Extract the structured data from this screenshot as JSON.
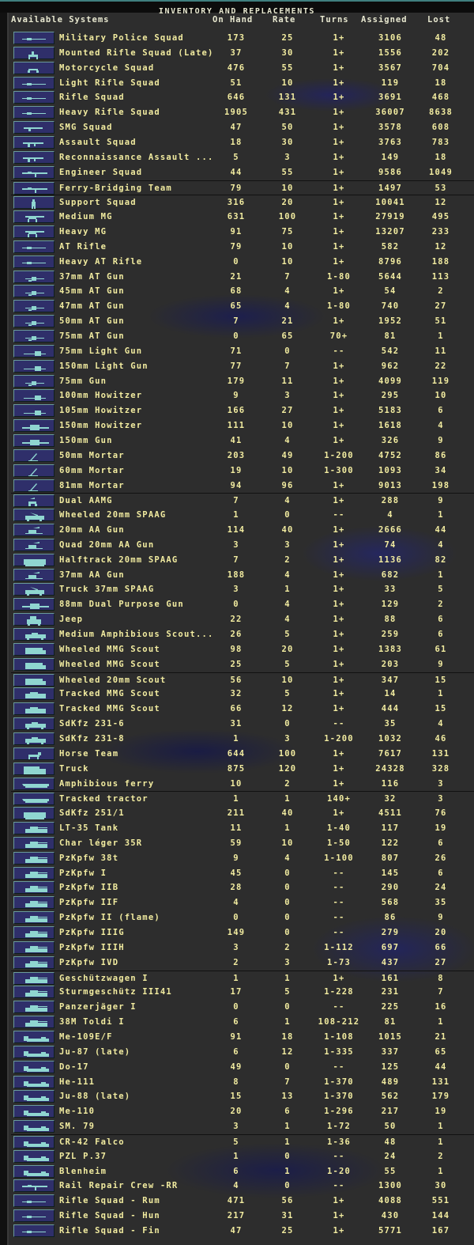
{
  "window_title": "INVENTORY AND REPLACEMENTS",
  "columns": [
    "Available Systems",
    "On Hand",
    "Rate",
    "Turns",
    "Assigned",
    "Lost"
  ],
  "rows": [
    [
      "Military Police Squad",
      "173",
      "25",
      "1+",
      "3106",
      "48",
      "rifle"
    ],
    [
      "Mounted Rifle Squad (Late)",
      "37",
      "30",
      "1+",
      "1556",
      "202",
      "horse-rider"
    ],
    [
      "Motorcycle Squad",
      "476",
      "55",
      "1+",
      "3567",
      "704",
      "motorcycle"
    ],
    [
      "Light Rifle Squad",
      "51",
      "10",
      "1+",
      "119",
      "18",
      "rifle"
    ],
    [
      "Rifle Squad",
      "646",
      "131",
      "1+",
      "3691",
      "468",
      "rifle"
    ],
    [
      "Heavy Rifle Squad",
      "1905",
      "431",
      "1+",
      "36007",
      "8638",
      "rifle"
    ],
    [
      "SMG Squad",
      "47",
      "50",
      "1+",
      "3578",
      "608",
      "smg"
    ],
    [
      "Assault Squad",
      "18",
      "30",
      "1+",
      "3763",
      "783",
      "assault-rifle"
    ],
    [
      "Reconnaissance Assault ...",
      "5",
      "3",
      "1+",
      "149",
      "18",
      "assault-rifle"
    ],
    [
      "Engineer Squad",
      "44",
      "55",
      "1+",
      "9586",
      "1049",
      "engineer"
    ],
    [
      "Ferry-Bridging Team",
      "79",
      "10",
      "1+",
      "1497",
      "53",
      "engineer"
    ],
    [
      "Support Squad",
      "316",
      "20",
      "1+",
      "10041",
      "12",
      "soldier"
    ],
    [
      "Medium MG",
      "631",
      "100",
      "1+",
      "27919",
      "495",
      "machine-gun"
    ],
    [
      "Heavy MG",
      "91",
      "75",
      "1+",
      "13207",
      "233",
      "machine-gun"
    ],
    [
      "AT Rifle",
      "79",
      "10",
      "1+",
      "582",
      "12",
      "rifle"
    ],
    [
      "Heavy AT Rifle",
      "0",
      "10",
      "1+",
      "8796",
      "188",
      "rifle"
    ],
    [
      "37mm AT Gun",
      "21",
      "7",
      "1-80",
      "5644",
      "113",
      "at-gun"
    ],
    [
      "45mm AT Gun",
      "68",
      "4",
      "1+",
      "54",
      "2",
      "at-gun"
    ],
    [
      "47mm AT Gun",
      "65",
      "4",
      "1-80",
      "740",
      "27",
      "at-gun"
    ],
    [
      "50mm AT Gun",
      "7",
      "21",
      "1+",
      "1952",
      "51",
      "at-gun"
    ],
    [
      "75mm AT Gun",
      "0",
      "65",
      "70+",
      "81",
      "1",
      "at-gun"
    ],
    [
      "75mm Light Gun",
      "71",
      "0",
      "--",
      "542",
      "11",
      "field-gun"
    ],
    [
      "150mm Light Gun",
      "77",
      "7",
      "1+",
      "962",
      "22",
      "field-gun"
    ],
    [
      "75mm Gun",
      "179",
      "11",
      "1+",
      "4099",
      "119",
      "at-gun"
    ],
    [
      "100mm Howitzer",
      "9",
      "3",
      "1+",
      "295",
      "10",
      "field-gun"
    ],
    [
      "105mm Howitzer",
      "166",
      "27",
      "1+",
      "5183",
      "6",
      "field-gun"
    ],
    [
      "150mm Howitzer",
      "111",
      "10",
      "1+",
      "1618",
      "4",
      "heavy-gun"
    ],
    [
      "150mm Gun",
      "41",
      "4",
      "1+",
      "326",
      "9",
      "heavy-gun"
    ],
    [
      "50mm Mortar",
      "203",
      "49",
      "1-200",
      "4752",
      "86",
      "mortar"
    ],
    [
      "60mm Mortar",
      "19",
      "10",
      "1-300",
      "1093",
      "34",
      "mortar"
    ],
    [
      "81mm Mortar",
      "94",
      "96",
      "1+",
      "9013",
      "198",
      "mortar"
    ],
    [
      "Dual AAMG",
      "7",
      "4",
      "1+",
      "288",
      "9",
      "aa-mg"
    ],
    [
      "Wheeled 20mm SPAAG",
      "1",
      "0",
      "--",
      "4",
      "1",
      "truck-aa"
    ],
    [
      "20mm AA Gun",
      "114",
      "40",
      "1+",
      "2666",
      "44",
      "aa-gun"
    ],
    [
      "Quad 20mm AA Gun",
      "3",
      "3",
      "1+",
      "74",
      "4",
      "aa-gun"
    ],
    [
      "Halftrack 20mm SPAAG",
      "7",
      "2",
      "1+",
      "1136",
      "82",
      "halftrack"
    ],
    [
      "37mm AA Gun",
      "188",
      "4",
      "1+",
      "682",
      "1",
      "aa-gun"
    ],
    [
      "Truck 37mm SPAAG",
      "3",
      "1",
      "1+",
      "33",
      "5",
      "truck-aa"
    ],
    [
      "88mm Dual Purpose Gun",
      "0",
      "4",
      "1+",
      "129",
      "2",
      "heavy-gun"
    ],
    [
      "Jeep",
      "22",
      "4",
      "1+",
      "88",
      "6",
      "jeep"
    ],
    [
      "Medium Amphibious Scout...",
      "26",
      "5",
      "1+",
      "259",
      "6",
      "armored-car"
    ],
    [
      "Wheeled MMG Scout",
      "98",
      "20",
      "1+",
      "1383",
      "61",
      "scout-car"
    ],
    [
      "Wheeled MMG Scout",
      "25",
      "5",
      "1+",
      "203",
      "9",
      "scout-car"
    ],
    [
      "Wheeled 20mm Scout",
      "56",
      "10",
      "1+",
      "347",
      "15",
      "scout-car"
    ],
    [
      "Tracked MMG Scout",
      "32",
      "5",
      "1+",
      "14",
      "1",
      "tracked-scout"
    ],
    [
      "Tracked MMG Scout",
      "66",
      "12",
      "1+",
      "444",
      "15",
      "tracked-scout"
    ],
    [
      "SdKfz 231-6",
      "31",
      "0",
      "--",
      "35",
      "4",
      "armored-car"
    ],
    [
      "SdKfz 231-8",
      "1",
      "3",
      "1-200",
      "1032",
      "46",
      "armored-car"
    ],
    [
      "Horse Team",
      "644",
      "100",
      "1+",
      "7617",
      "131",
      "horse"
    ],
    [
      "Truck",
      "875",
      "120",
      "1+",
      "24328",
      "328",
      "truck"
    ],
    [
      "Amphibious ferry",
      "10",
      "2",
      "1+",
      "116",
      "3",
      "boat"
    ],
    [
      "Tracked tractor",
      "1",
      "1",
      "140+",
      "32",
      "3",
      "boat"
    ],
    [
      "SdKfz 251/1",
      "211",
      "40",
      "1+",
      "4511",
      "76",
      "halftrack"
    ],
    [
      "LT-35 Tank",
      "11",
      "1",
      "1-40",
      "117",
      "19",
      "tank"
    ],
    [
      "Char léger 35R",
      "59",
      "10",
      "1-50",
      "122",
      "6",
      "tank"
    ],
    [
      "PzKpfw 38t",
      "9",
      "4",
      "1-100",
      "807",
      "26",
      "tank"
    ],
    [
      "PzKpfw I",
      "45",
      "0",
      "--",
      "145",
      "6",
      "tank"
    ],
    [
      "PzKpfw IIB",
      "28",
      "0",
      "--",
      "290",
      "24",
      "tank"
    ],
    [
      "PzKpfw IIF",
      "4",
      "0",
      "--",
      "568",
      "35",
      "tank"
    ],
    [
      "PzKpfw II (flame)",
      "0",
      "0",
      "--",
      "86",
      "9",
      "tank"
    ],
    [
      "PzKpfw IIIG",
      "149",
      "0",
      "--",
      "279",
      "20",
      "tank"
    ],
    [
      "PzKpfw IIIH",
      "3",
      "2",
      "1-112",
      "697",
      "66",
      "tank"
    ],
    [
      "PzKpfw IVD",
      "2",
      "3",
      "1-73",
      "437",
      "27",
      "tank"
    ],
    [
      "Geschützwagen I",
      "1",
      "1",
      "1+",
      "161",
      "8",
      "tank"
    ],
    [
      "Sturmgeschütz III41",
      "17",
      "5",
      "1-228",
      "231",
      "7",
      "tank"
    ],
    [
      "Panzerjäger I",
      "0",
      "0",
      "--",
      "225",
      "16",
      "tank"
    ],
    [
      "38M Toldi I",
      "6",
      "1",
      "108-212",
      "81",
      "1",
      "tank"
    ],
    [
      "Me-109E/F",
      "91",
      "18",
      "1-108",
      "1015",
      "21",
      "plane"
    ],
    [
      "Ju-87 (late)",
      "6",
      "12",
      "1-335",
      "337",
      "65",
      "plane"
    ],
    [
      "Do-17",
      "49",
      "0",
      "--",
      "125",
      "44",
      "plane"
    ],
    [
      "He-111",
      "8",
      "7",
      "1-370",
      "489",
      "131",
      "plane"
    ],
    [
      "Ju-88 (late)",
      "15",
      "13",
      "1-370",
      "562",
      "179",
      "plane"
    ],
    [
      "Me-110",
      "20",
      "6",
      "1-296",
      "217",
      "19",
      "plane"
    ],
    [
      "SM. 79",
      "3",
      "1",
      "1-72",
      "50",
      "1",
      "plane"
    ],
    [
      "CR-42 Falco",
      "5",
      "1",
      "1-36",
      "48",
      "1",
      "plane"
    ],
    [
      "PZL P.37",
      "1",
      "0",
      "--",
      "24",
      "2",
      "plane"
    ],
    [
      "Blenheim",
      "6",
      "1",
      "1-20",
      "55",
      "1",
      "plane"
    ],
    [
      "Rail Repair Crew -RR",
      "4",
      "0",
      "--",
      "1300",
      "30",
      "engineer"
    ],
    [
      "Rifle Squad - Rum",
      "471",
      "56",
      "1+",
      "4088",
      "551",
      "rifle"
    ],
    [
      "Rifle Squad - Hun",
      "217",
      "31",
      "1+",
      "430",
      "144",
      "rifle"
    ],
    [
      "Rifle Squad - Fin",
      "47",
      "25",
      "1+",
      "5771",
      "167",
      "rifle"
    ]
  ],
  "colors": {
    "text": "#f2eca0",
    "header": "#e8e8d0",
    "button": "#2f2f6a",
    "icon": "#8fd6d0"
  }
}
